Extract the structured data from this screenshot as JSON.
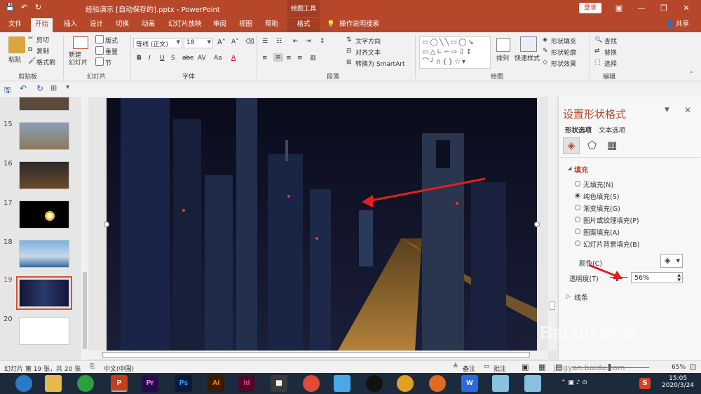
{
  "titlebar": {
    "title": "经验演示 [自动保存的].pptx  -  PowerPoint",
    "context_tool": "绘图工具",
    "login_label": "登录",
    "share_label": "共享"
  },
  "tabs": [
    "文件",
    "开始",
    "插入",
    "设计",
    "切换",
    "动画",
    "幻灯片放映",
    "审阅",
    "视图",
    "帮助",
    "格式"
  ],
  "tell_me": "操作说明搜索",
  "ribbon": {
    "clipboard": {
      "paste": "粘贴",
      "cut": "剪切",
      "copy": "复制",
      "format_painter": "格式刷",
      "label": "剪贴板"
    },
    "slides": {
      "new_slide": "新建\n幻灯片",
      "layout": "版式",
      "reset": "重置",
      "section": "节",
      "label": "幻灯片"
    },
    "font": {
      "name": "等线 (正文)",
      "size": "18",
      "label": "字体",
      "buttons": [
        "B",
        "I",
        "U",
        "S",
        "abc",
        "AV",
        "Aa",
        "A"
      ]
    },
    "paragraph": {
      "text_direction": "文字方向",
      "align_text": "对齐文本",
      "smartart": "转换为 SmartArt",
      "label": "段落"
    },
    "drawing": {
      "arrange": "排列",
      "quick_styles": "快速样式",
      "shape_fill": "形状填充",
      "shape_outline": "形状轮廓",
      "shape_effects": "形状效果",
      "label": "绘图"
    },
    "editing": {
      "find": "查找",
      "replace": "替换",
      "select": "选择",
      "label": "编辑"
    }
  },
  "thumbnails": [
    {
      "num": "",
      "color": "#5a4a3a"
    },
    {
      "num": "15",
      "color": "#8a7a5a"
    },
    {
      "num": "16",
      "color": "#4a3a2a"
    },
    {
      "num": "17",
      "color": "#000000"
    },
    {
      "num": "18",
      "color": "#6aa0d0"
    },
    {
      "num": "19",
      "color": "#1a1a3a"
    },
    {
      "num": "20",
      "color": "#ffffff"
    }
  ],
  "pane": {
    "title": "设置形状格式",
    "tab_shape": "形状选项",
    "tab_text": "文本选项",
    "fill_section": "填充",
    "options": [
      "无填充(N)",
      "纯色填充(S)",
      "渐变填充(G)",
      "图片或纹理填充(P)",
      "图案填充(A)",
      "幻灯片背景填充(B)"
    ],
    "selected_option": "纯色填充(S)",
    "color_label": "颜色(C)",
    "transparency_label": "透明度(T)",
    "transparency_value": "56%",
    "line_section": "线条"
  },
  "status": {
    "slide_info": "幻灯片 第 19 张，共 20 张",
    "language": "中文(中国)",
    "notes": "备注",
    "comments": "批注",
    "zoom": "65%"
  },
  "taskbar": {
    "apps": [
      "Pr",
      "Ps",
      "Ai",
      "Id"
    ],
    "time": "15:05",
    "date": "2020/3/24"
  },
  "watermark": {
    "brand": "Bai du 经验",
    "url": "jingyan.baidu.com"
  },
  "colors": {
    "accent": "#b7472a",
    "selection": "#d35230",
    "arrow": "#e02020"
  }
}
